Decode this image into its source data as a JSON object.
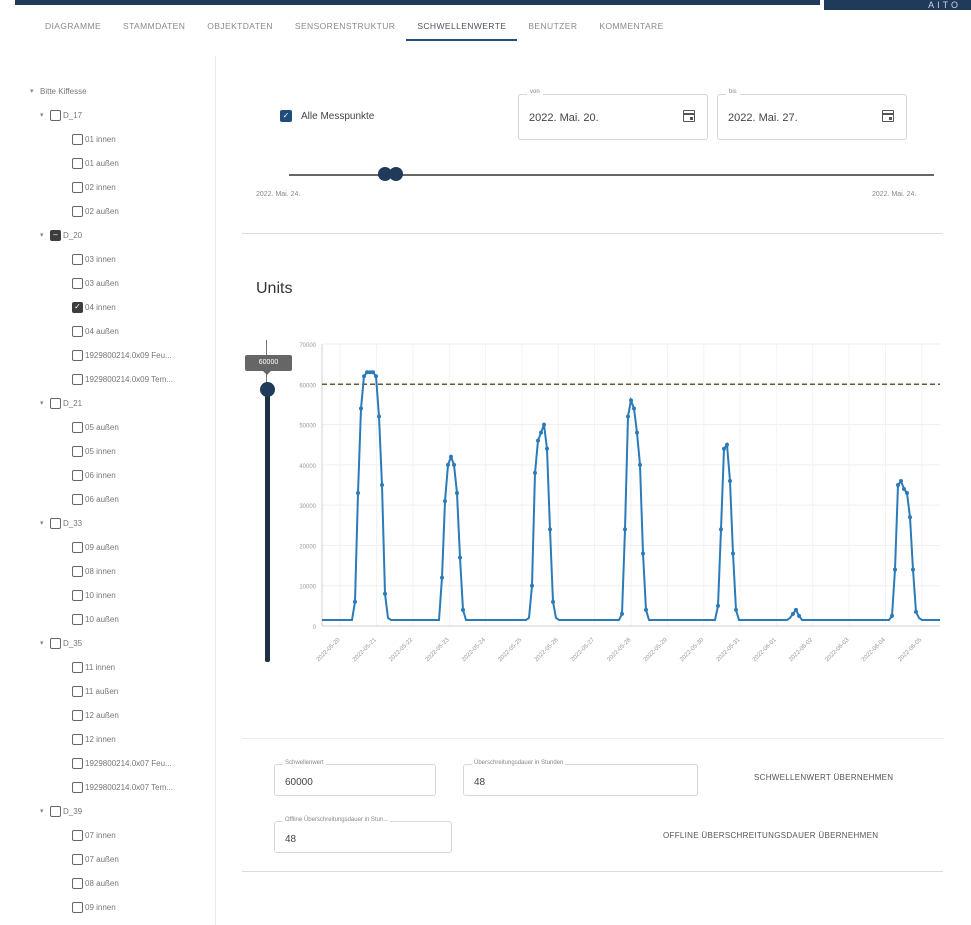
{
  "app": {
    "brand_text": "AITO"
  },
  "tabs": [
    "Diagramme",
    "Stammdaten",
    "Objektdaten",
    "Sensorenstruktur",
    "Schwellenwerte",
    "Benutzer",
    "Kommentare"
  ],
  "active_tab": "Schwellenwerte",
  "sidebar": {
    "root": "Bitte Kiffesse",
    "groups": [
      {
        "label": "D_17",
        "state": "unchecked",
        "items": [
          {
            "label": "01 innen",
            "checked": false
          },
          {
            "label": "01 außen",
            "checked": false
          },
          {
            "label": "02 innen",
            "checked": false
          },
          {
            "label": "02 außen",
            "checked": false
          }
        ]
      },
      {
        "label": "D_20",
        "state": "partial",
        "items": [
          {
            "label": "03 innen",
            "checked": false
          },
          {
            "label": "03 außen",
            "checked": false
          },
          {
            "label": "04 innen",
            "checked": true
          },
          {
            "label": "04 außen",
            "checked": false
          },
          {
            "label": "1929800214.0x09 Feu...",
            "checked": false
          },
          {
            "label": "1929800214.0x09 Tem...",
            "checked": false
          }
        ]
      },
      {
        "label": "D_21",
        "state": "unchecked",
        "items": [
          {
            "label": "05 außen",
            "checked": false
          },
          {
            "label": "05 innen",
            "checked": false
          },
          {
            "label": "06 innen",
            "checked": false
          },
          {
            "label": "06 außen",
            "checked": false
          }
        ]
      },
      {
        "label": "D_33",
        "state": "unchecked",
        "items": [
          {
            "label": "09 außen",
            "checked": false
          },
          {
            "label": "08 innen",
            "checked": false
          },
          {
            "label": "10 innen",
            "checked": false
          },
          {
            "label": "10 außen",
            "checked": false
          }
        ]
      },
      {
        "label": "D_35",
        "state": "unchecked",
        "items": [
          {
            "label": "11 innen",
            "checked": false
          },
          {
            "label": "11 außen",
            "checked": false
          },
          {
            "label": "12 außen",
            "checked": false
          },
          {
            "label": "12 innen",
            "checked": false
          },
          {
            "label": "1929800214.0x07 Feu...",
            "checked": false
          },
          {
            "label": "1929800214.0x07 Tem...",
            "checked": false
          }
        ]
      },
      {
        "label": "D_39",
        "state": "unchecked",
        "items": [
          {
            "label": "07 innen",
            "checked": false
          },
          {
            "label": "07 außen",
            "checked": false
          },
          {
            "label": "08 außen",
            "checked": false
          },
          {
            "label": "09 innen",
            "checked": false
          }
        ]
      }
    ]
  },
  "filter": {
    "all_points_label": "Alle Messpunkte",
    "all_points_checked": true,
    "from_label": "von",
    "from_value": "2022. Mai. 20.",
    "to_label": "bis",
    "to_value": "2022. Mai. 27.",
    "range_start_label": "2022. Mai. 24.",
    "range_end_label": "2022. Mai. 24."
  },
  "chart_data": {
    "type": "line",
    "title": "Units",
    "ylim": [
      0,
      70000
    ],
    "yticks": [
      0,
      10000,
      20000,
      30000,
      40000,
      50000,
      60000,
      70000
    ],
    "threshold": 60000,
    "threshold_badge": "60000",
    "x_tick_labels": [
      "2022-05-20",
      "2022-05-21",
      "2022-05-22",
      "2022-05-23",
      "2022-05-24",
      "2022-05-25",
      "2022-05-26",
      "2022-05-27",
      "2022-05-28",
      "2022-05-29",
      "2022-05-30",
      "2022-05-31",
      "2022-06-01",
      "2022-06-02",
      "2022-06-03",
      "2022-06-04",
      "2022-06-05"
    ],
    "x": [
      0,
      3,
      6,
      9,
      12,
      15,
      18,
      21,
      24,
      27,
      30,
      33,
      36,
      39,
      42,
      45,
      48,
      51,
      54,
      57,
      60,
      63,
      66,
      69,
      72,
      75,
      78,
      81,
      84,
      87,
      90,
      93,
      96,
      99,
      102,
      105,
      108,
      111,
      114,
      117,
      120,
      123,
      126,
      129,
      132,
      135,
      138,
      141,
      144,
      147,
      150,
      153,
      156,
      159,
      162,
      165,
      168,
      171,
      174,
      177,
      180,
      183,
      186,
      189,
      192,
      195,
      198,
      201,
      204,
      207,
      210,
      213,
      216,
      219,
      222,
      225,
      228,
      231,
      234,
      237,
      240,
      243,
      246,
      249,
      252,
      255,
      258,
      261,
      264,
      267,
      270,
      273,
      276,
      279,
      282,
      285,
      288,
      291,
      294,
      297,
      300,
      303,
      306,
      309,
      312,
      315,
      318,
      321,
      324,
      327,
      330,
      333,
      336,
      339,
      342,
      345,
      348,
      351,
      354,
      357,
      360,
      363,
      366,
      369,
      372,
      375,
      378,
      381,
      384,
      387,
      390,
      393,
      396,
      399,
      402,
      405,
      408,
      411,
      414,
      417,
      420,
      423,
      426,
      429,
      432,
      435,
      438,
      441,
      444,
      447,
      450,
      453,
      456,
      459,
      462,
      465,
      468,
      471,
      474,
      477,
      480,
      483,
      486,
      489,
      492,
      495,
      498,
      501,
      504,
      507,
      510,
      513,
      516,
      519,
      522,
      525,
      528,
      531,
      534,
      537,
      540,
      543,
      546,
      549,
      552,
      555,
      558,
      561,
      564,
      567,
      570,
      573,
      576,
      579,
      582,
      585,
      588,
      591,
      594,
      597,
      600,
      603,
      606,
      609,
      612,
      615,
      618
    ],
    "series": [
      {
        "values": [
          1500,
          1500,
          1500,
          1500,
          1500,
          1500,
          1500,
          1500,
          1500,
          1500,
          1500,
          6000,
          33000,
          54000,
          62000,
          63000,
          63000,
          63000,
          62000,
          52000,
          35000,
          8000,
          2000,
          1500,
          1500,
          1500,
          1500,
          1500,
          1500,
          1500,
          1500,
          1500,
          1500,
          1500,
          1500,
          1500,
          1500,
          1500,
          1500,
          1500,
          12000,
          31000,
          40000,
          42000,
          40000,
          33000,
          17000,
          4000,
          1500,
          1500,
          1500,
          1500,
          1500,
          1500,
          1500,
          1500,
          1500,
          1500,
          1500,
          1500,
          1500,
          1500,
          1500,
          1500,
          1500,
          1500,
          1500,
          1500,
          1500,
          2000,
          10000,
          38000,
          46000,
          48000,
          50000,
          44000,
          24000,
          6000,
          2000,
          1500,
          1500,
          1500,
          1500,
          1500,
          1500,
          1500,
          1500,
          1500,
          1500,
          1500,
          1500,
          1500,
          1500,
          1500,
          1500,
          1500,
          1500,
          1500,
          1500,
          1500,
          3000,
          24000,
          52000,
          56000,
          54000,
          48000,
          40000,
          18000,
          4000,
          1500,
          1500,
          1500,
          1500,
          1500,
          1500,
          1500,
          1500,
          1500,
          1500,
          1500,
          1500,
          1500,
          1500,
          1500,
          1500,
          1500,
          1500,
          1500,
          1500,
          1500,
          1500,
          1500,
          5000,
          24000,
          44000,
          45000,
          36000,
          18000,
          4000,
          1500,
          1500,
          1500,
          1500,
          1500,
          1500,
          1500,
          1500,
          1500,
          1500,
          1500,
          1500,
          1500,
          1500,
          1500,
          1500,
          1500,
          2000,
          3000,
          4000,
          2500,
          1500,
          1500,
          1500,
          1500,
          1500,
          1500,
          1500,
          1500,
          1500,
          1500,
          1500,
          1500,
          1500,
          1500,
          1500,
          1500,
          1500,
          1500,
          1500,
          1500,
          1500,
          1500,
          1500,
          1500,
          1500,
          1500,
          1500,
          1500,
          1500,
          1500,
          2500,
          14000,
          35000,
          36000,
          34000,
          33000,
          27000,
          14000,
          3500,
          2000,
          1500,
          1500,
          1500,
          1500,
          1500,
          1500,
          1500,
          1500,
          1500,
          1500,
          1500,
          1500,
          1500,
          1500,
          1500,
          1500
        ]
      }
    ]
  },
  "form": {
    "threshold_label": "Schwellenwert",
    "threshold_value": "60000",
    "duration_label": "Überschreitungsdauer in Stunden",
    "duration_value": "48",
    "apply_threshold_label": "Schwellenwert übernehmen",
    "offline_label": "Offline Überschreitungsdauer in Stun...",
    "offline_value": "48",
    "apply_offline_label": "Offline Überschreitungsdauer übernehmen"
  },
  "colors": {
    "primary": "#1e4e79",
    "series": "#2b7bb9",
    "threshold": "#6b5440",
    "dark": "#1f3a5a"
  }
}
